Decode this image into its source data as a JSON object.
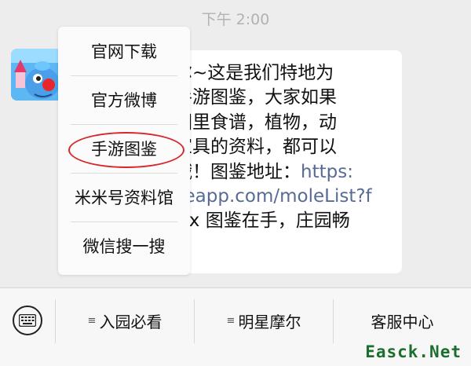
{
  "timestamp": "下午 2:00",
  "chat": {
    "avatar_icon": "game-avatar-icon",
    "message_lines": [
      "尔~这是我们特地为",
      "手游图鉴，大家如果",
      "园里食谱，植物，动",
      "家具的资料，都可以",
      "哦！图鉴地址：",
      "keapp.com/moleList?f",
      "wx 图鉴在手，庄园畅"
    ],
    "link_inline": "https:"
  },
  "popup_menu": {
    "items": [
      "官网下载",
      "官方微博",
      "手游图鉴",
      "米米号资料馆",
      "微信搜一搜"
    ],
    "highlighted_index": 2,
    "highlight_color": "#d6282b"
  },
  "bottom_bar": {
    "keyboard_icon": "keyboard-icon",
    "tabs": [
      "入园必看",
      "明星摩尔",
      "客服中心"
    ],
    "tab_menu_glyph": "≡"
  },
  "watermark": "Easck.Net"
}
